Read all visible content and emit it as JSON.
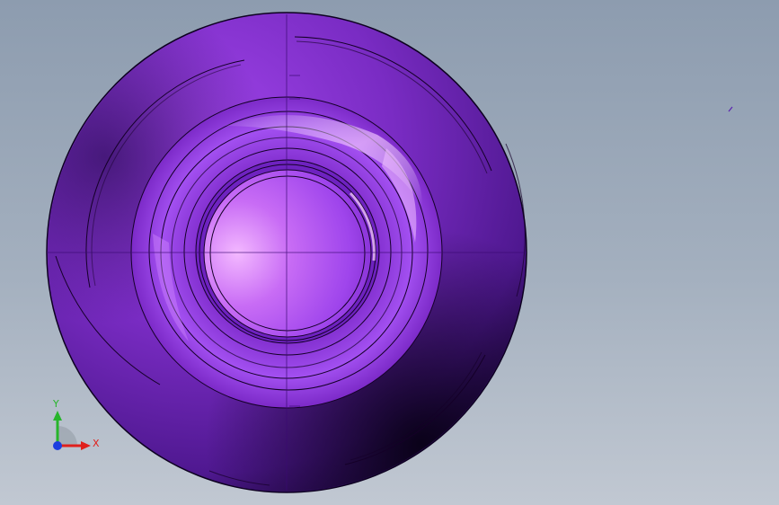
{
  "viewport": {
    "colors": {
      "background_top": "#8d9caf",
      "background_bottom": "#c1c8d2",
      "part_body": "#6a1fb0",
      "part_highlight": "#e6a6ff",
      "edge_lines": "#150028"
    }
  },
  "triad": {
    "x_label": "X",
    "y_label": "Y",
    "colors": {
      "x": "#e0201c",
      "y": "#27b52b",
      "z": "#1c3ee0"
    }
  }
}
